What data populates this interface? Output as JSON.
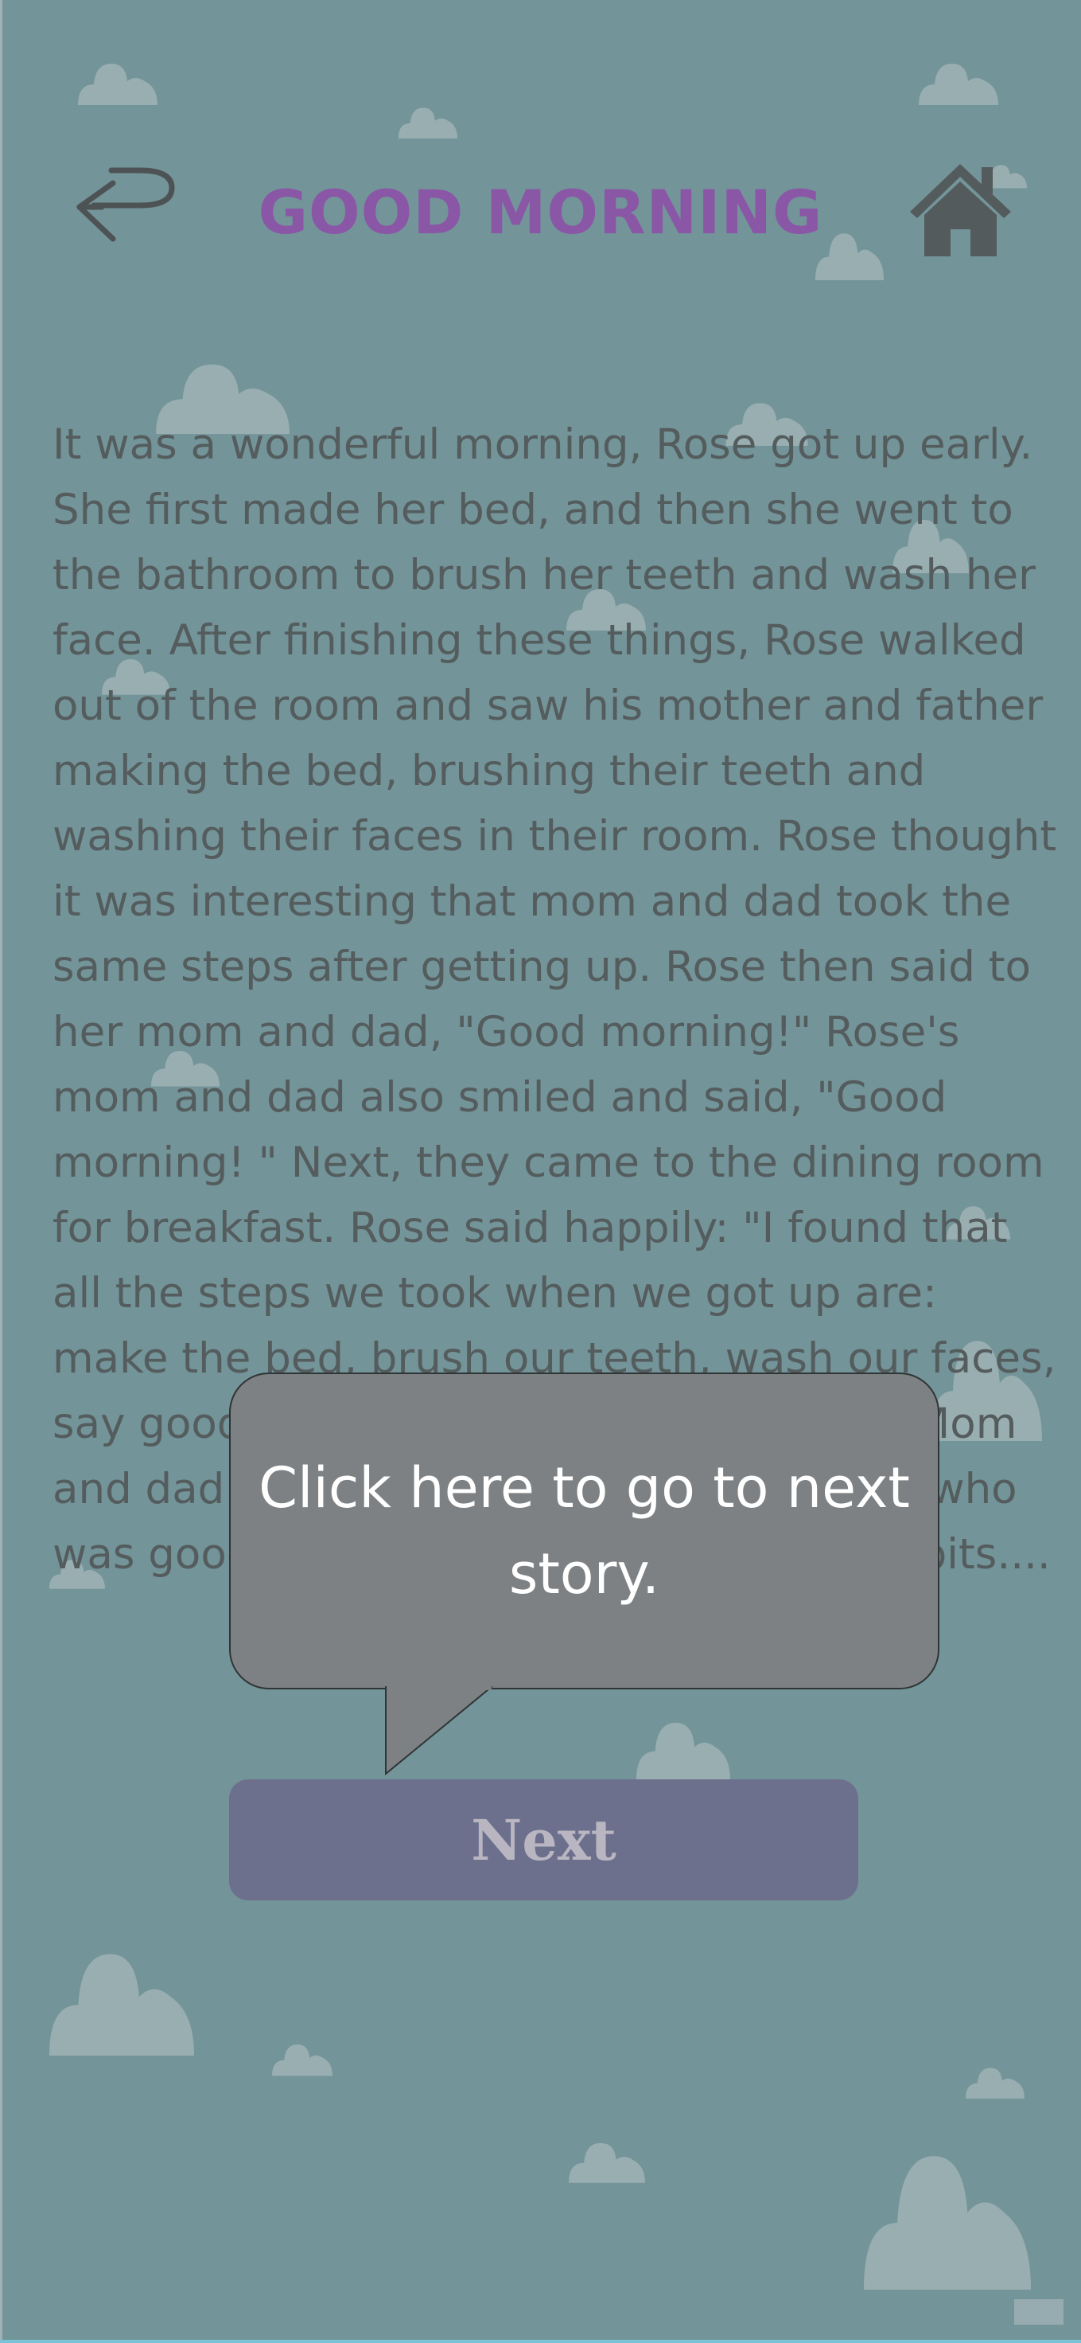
{
  "header": {
    "title": "GOOD MORNING",
    "back_icon": "return-arrow-icon",
    "home_icon": "home-icon"
  },
  "story": {
    "text": "It was a wonderful morning, Rose got up early. She first made her bed, and then she went to the bathroom to brush her teeth and wash her face. After finishing these things, Rose walked out of the room and saw his mother and father making the bed, brushing their teeth and washing their faces in their room. Rose thought it was interesting that mom and dad took the same steps after getting up. Rose then said to her mom and dad, \"Good morning!\" Rose's mom and dad also smiled and said, \"Good morning! \" Next, they came to the dining room for breakfast. Rose said happily: \"I found that all the steps we took when we got up are: make the bed, brush our teeth, wash our faces, say good morning, and have breakfast.\" Mom and dad found that Rose was a good boy who was good at finding out and had good habits...."
  },
  "tooltip": {
    "text": "Click here to go to next story."
  },
  "next_button": {
    "label": "Next"
  },
  "colors": {
    "background": "#739499",
    "title": "#8a56a6",
    "text": "#545c5d",
    "button": "#6d708d",
    "tooltip": "#7d8183"
  }
}
